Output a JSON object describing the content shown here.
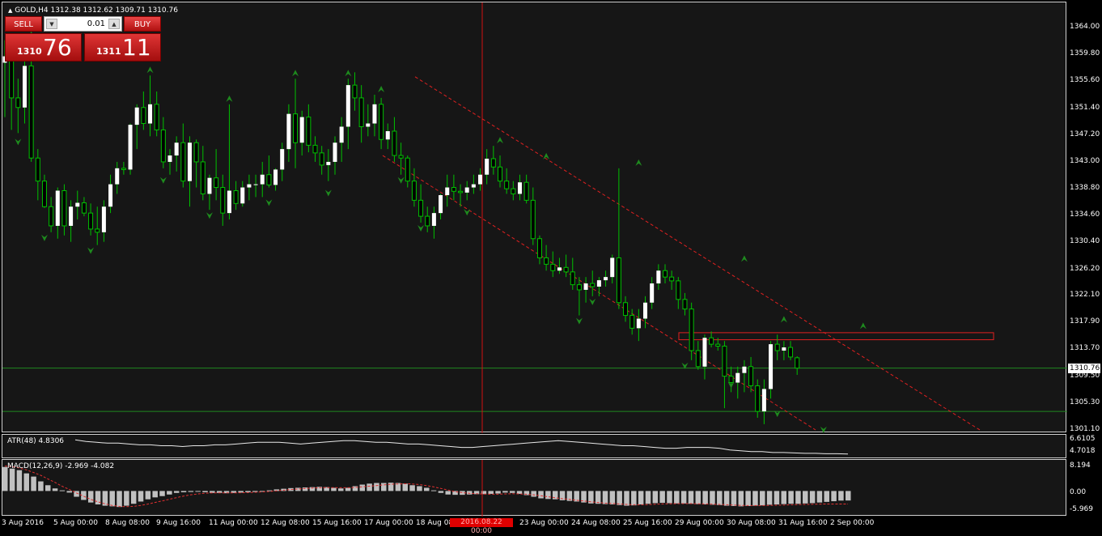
{
  "window": {
    "title": "GOLD,H4  1312.38 1312.62 1309.71 1310.76",
    "symbol_menu_icon": "triangle-up-icon"
  },
  "trade_panel": {
    "sell_label": "SELL",
    "buy_label": "BUY",
    "lot_value": "0.01",
    "sell_price_prefix": "1310",
    "sell_price_big": "76",
    "buy_price_prefix": "1311",
    "buy_price_big": "11"
  },
  "price_axis": {
    "labels": [
      "1364.00",
      "1359.80",
      "1355.60",
      "1351.40",
      "1347.20",
      "1343.00",
      "1338.80",
      "1334.60",
      "1330.40",
      "1326.20",
      "1322.10",
      "1317.90",
      "1313.70",
      "1310.76",
      "1309.50",
      "1305.30",
      "1301.10"
    ],
    "current_price": "1310.76"
  },
  "atr": {
    "title": "ATR(48) 4.8306",
    "axis": [
      "6.6105",
      "4.7018"
    ]
  },
  "macd": {
    "title": "MACD(12,26,9) -2.969 -4.082",
    "axis": [
      "8.194",
      "0.00",
      "-5.969"
    ]
  },
  "time_axis": {
    "labels": [
      "3 Aug 2016",
      "5 Aug 00:00",
      "8 Aug 08:00",
      "9 Aug 16:00",
      "11 Aug 00:00",
      "12 Aug 08:00",
      "15 Aug 16:00",
      "17 Aug 00:00",
      "18 Aug 08:00",
      "23 Aug 00:00",
      "24 Aug 08:00",
      "25 Aug 16:00",
      "29 Aug 00:00",
      "30 Aug 08:00",
      "31 Aug 16:00",
      "2 Sep 00:00"
    ],
    "crosshair_time": "2016.08.22 00:00"
  },
  "colors": {
    "background": "#161616",
    "bull": "#ffffff",
    "bear": "#000000",
    "wick": "#00c000",
    "fractal": "#1e8a1e",
    "channel": "#e02020",
    "level": "#1f8a1f",
    "macd_hist": "#c0c0c0",
    "macd_signal": "#e03030"
  },
  "chart_data": {
    "type": "candlestick",
    "symbol": "GOLD",
    "timeframe": "H4",
    "ohlc_last": {
      "open": 1312.38,
      "high": 1312.62,
      "low": 1309.71,
      "close": 1310.76
    },
    "ylim": [
      1301.1,
      1364.0
    ],
    "candles": [
      [
        1358.5,
        1362,
        1350,
        1359.5
      ],
      [
        1359.5,
        1361.5,
        1348,
        1353
      ],
      [
        1353,
        1356,
        1347.5,
        1351.5
      ],
      [
        1351.5,
        1359,
        1349,
        1358
      ],
      [
        1358,
        1362,
        1343,
        1343.6
      ],
      [
        1343.6,
        1345,
        1337,
        1340
      ],
      [
        1340,
        1341,
        1335.8,
        1336
      ],
      [
        1336,
        1337.5,
        1332,
        1333
      ],
      [
        1333,
        1339,
        1331,
        1338.5
      ],
      [
        1338.5,
        1339.5,
        1331.5,
        1333
      ],
      [
        1333,
        1337,
        1330.5,
        1336
      ],
      [
        1336,
        1338.5,
        1334,
        1336.6
      ],
      [
        1336.6,
        1337.5,
        1334.5,
        1335
      ],
      [
        1335,
        1336.5,
        1331.5,
        1332.5
      ],
      [
        1332.5,
        1336,
        1330,
        1332
      ],
      [
        1332,
        1337,
        1330.5,
        1336
      ],
      [
        1336,
        1341,
        1335,
        1339.5
      ],
      [
        1339.5,
        1343,
        1338,
        1342
      ],
      [
        1342,
        1343,
        1341,
        1341.8
      ],
      [
        1341.8,
        1349,
        1341,
        1348.8
      ],
      [
        1348.8,
        1352,
        1345,
        1351.5
      ],
      [
        1351.5,
        1354,
        1348,
        1349
      ],
      [
        1349,
        1356.5,
        1347,
        1352
      ],
      [
        1352,
        1354,
        1347,
        1348
      ],
      [
        1348,
        1350,
        1342,
        1343
      ],
      [
        1343,
        1345,
        1341,
        1344
      ],
      [
        1344,
        1347,
        1341.5,
        1346
      ],
      [
        1346,
        1349,
        1339,
        1340
      ],
      [
        1340,
        1347,
        1336,
        1346
      ],
      [
        1346,
        1346.5,
        1339,
        1343
      ],
      [
        1343,
        1345.5,
        1337,
        1338
      ],
      [
        1338,
        1341,
        1335.5,
        1340.5
      ],
      [
        1340.5,
        1345,
        1337,
        1339
      ],
      [
        1339,
        1341,
        1333,
        1335
      ],
      [
        1335,
        1352,
        1334,
        1338.5
      ],
      [
        1338.5,
        1340,
        1335.5,
        1336.5
      ],
      [
        1336.5,
        1340,
        1336,
        1339
      ],
      [
        1339,
        1341,
        1337,
        1339.5
      ],
      [
        1339.5,
        1341,
        1337.5,
        1339.5
      ],
      [
        1339.5,
        1343,
        1337.5,
        1341
      ],
      [
        1341,
        1344,
        1339,
        1339.4
      ],
      [
        1339.4,
        1342,
        1338.5,
        1341.8
      ],
      [
        1341.8,
        1346,
        1340,
        1345
      ],
      [
        1345,
        1352,
        1343,
        1350.5
      ],
      [
        1350.5,
        1356,
        1342,
        1346
      ],
      [
        1346,
        1351,
        1344,
        1350
      ],
      [
        1350,
        1352,
        1344.5,
        1345.6
      ],
      [
        1345.6,
        1347,
        1343,
        1344.4
      ],
      [
        1344.4,
        1345.5,
        1341,
        1342.5
      ],
      [
        1342.5,
        1345,
        1340,
        1343
      ],
      [
        1343,
        1347,
        1341,
        1346
      ],
      [
        1346,
        1350,
        1343,
        1348.5
      ],
      [
        1348.5,
        1356,
        1345,
        1355
      ],
      [
        1355,
        1357,
        1351,
        1353
      ],
      [
        1353,
        1355,
        1346,
        1348.5
      ],
      [
        1348.5,
        1352,
        1347,
        1349
      ],
      [
        1349,
        1353.5,
        1347,
        1352
      ],
      [
        1352,
        1353,
        1345,
        1346.5
      ],
      [
        1346.5,
        1349,
        1345,
        1347.8
      ],
      [
        1347.8,
        1350,
        1343,
        1344
      ],
      [
        1344,
        1346,
        1341,
        1343.6
      ],
      [
        1343.6,
        1344,
        1339,
        1340
      ],
      [
        1340,
        1342,
        1336,
        1337
      ],
      [
        1337,
        1339.5,
        1333.5,
        1334.5
      ],
      [
        1334.5,
        1336,
        1332,
        1333
      ],
      [
        1333,
        1336,
        1331,
        1335
      ],
      [
        1335,
        1338,
        1334,
        1337.8
      ],
      [
        1337.8,
        1341,
        1336,
        1339
      ],
      [
        1339,
        1341,
        1337,
        1338.4
      ],
      [
        1338.4,
        1339.5,
        1336,
        1338.2
      ],
      [
        1338.2,
        1340,
        1337,
        1339
      ],
      [
        1339,
        1341,
        1338,
        1339.5
      ],
      [
        1339.5,
        1342,
        1338.5,
        1341
      ],
      [
        1341,
        1345,
        1339.5,
        1343.5
      ],
      [
        1343.5,
        1345.5,
        1341,
        1342.2
      ],
      [
        1342.2,
        1344,
        1339,
        1340
      ],
      [
        1340,
        1342,
        1338,
        1338.8
      ],
      [
        1338.8,
        1340,
        1337,
        1338
      ],
      [
        1338,
        1341,
        1337,
        1339.8
      ],
      [
        1339.8,
        1341,
        1336.5,
        1337
      ],
      [
        1337,
        1339,
        1330,
        1331
      ],
      [
        1331,
        1331.5,
        1327,
        1328
      ],
      [
        1328,
        1330,
        1326,
        1327
      ],
      [
        1327,
        1329,
        1325,
        1326
      ],
      [
        1326,
        1328,
        1325.5,
        1326.5
      ],
      [
        1326.5,
        1328.5,
        1325,
        1325.8
      ],
      [
        1325.8,
        1328,
        1323,
        1323.8
      ],
      [
        1323.8,
        1325,
        1319,
        1323
      ],
      [
        1323,
        1325,
        1321,
        1324
      ],
      [
        1324,
        1326,
        1322,
        1323.5
      ],
      [
        1323.5,
        1325,
        1322,
        1324.5
      ],
      [
        1324.5,
        1326,
        1323.5,
        1325
      ],
      [
        1325,
        1328.5,
        1324,
        1328
      ],
      [
        1328,
        1342,
        1320,
        1321
      ],
      [
        1321,
        1322,
        1318,
        1319
      ],
      [
        1319,
        1320,
        1316,
        1317
      ],
      [
        1317,
        1320,
        1315,
        1318.5
      ],
      [
        1318.5,
        1322,
        1317,
        1321
      ],
      [
        1321,
        1325,
        1320,
        1324
      ],
      [
        1324,
        1327,
        1323,
        1326
      ],
      [
        1326,
        1327,
        1324,
        1325
      ],
      [
        1325,
        1326,
        1323,
        1324.4
      ],
      [
        1324.4,
        1325,
        1320,
        1321.5
      ],
      [
        1321.5,
        1322.5,
        1319,
        1320
      ],
      [
        1320,
        1321,
        1312,
        1313.5
      ],
      [
        1313.5,
        1315,
        1310.5,
        1311
      ],
      [
        1311,
        1316,
        1309,
        1315.5
      ],
      [
        1315.5,
        1316.5,
        1314,
        1314.5
      ],
      [
        1314.5,
        1315.5,
        1313.5,
        1314.2
      ],
      [
        1314.2,
        1315,
        1304.5,
        1309.5
      ],
      [
        1309.5,
        1311,
        1307,
        1308.5
      ],
      [
        1308.5,
        1311,
        1306,
        1310
      ],
      [
        1310,
        1312,
        1307,
        1311
      ],
      [
        1311,
        1312.5,
        1307,
        1308
      ],
      [
        1308,
        1309,
        1303,
        1304
      ],
      [
        1304,
        1309,
        1302,
        1307.5
      ],
      [
        1307.5,
        1315,
        1306,
        1314.5
      ],
      [
        1314.5,
        1316,
        1312,
        1313.5
      ],
      [
        1313.5,
        1315,
        1312,
        1314
      ],
      [
        1314,
        1315,
        1312,
        1312.5
      ],
      [
        1312.38,
        1312.62,
        1309.71,
        1310.76
      ]
    ],
    "fractals_up": [
      [
        4,
        1362
      ],
      [
        22,
        1356.5
      ],
      [
        34,
        1352
      ],
      [
        44,
        1356
      ],
      [
        52,
        1356
      ],
      [
        57,
        1353.5
      ],
      [
        75,
        1345.5
      ],
      [
        82,
        1343
      ],
      [
        96,
        1342
      ],
      [
        112,
        1327
      ],
      [
        118,
        1317.5
      ],
      [
        130,
        1316.5
      ]
    ],
    "fractals_down": [
      [
        2,
        1347
      ],
      [
        6,
        1332
      ],
      [
        13,
        1330
      ],
      [
        24,
        1341
      ],
      [
        31,
        1335.5
      ],
      [
        40,
        1337.5
      ],
      [
        49,
        1339
      ],
      [
        60,
        1341
      ],
      [
        63,
        1333.5
      ],
      [
        70,
        1336
      ],
      [
        87,
        1319
      ],
      [
        89,
        1322
      ],
      [
        103,
        1312
      ],
      [
        110,
        1309
      ],
      [
        117,
        1304.5
      ],
      [
        124,
        1302
      ]
    ],
    "channel_upper": [
      [
        1326.5,
        1356.8
      ],
      [
        1332.0,
        1349.6
      ],
      [
        1337.5,
        1342.4
      ],
      [
        1343.0,
        1335.2
      ]
    ],
    "channel_lower": [
      [
        1301.1,
        1344.0
      ],
      [
        1313.0,
        1332.5
      ],
      [
        1320.0,
        1325.0
      ]
    ],
    "horizontal_levels": [
      1310.76,
      1304.0
    ],
    "resistance_zone": {
      "from_price": 1315.2,
      "to_price": 1316.3
    },
    "crosshair_time": "2016.08.22 00:00",
    "atr_series": [
      6.5,
      6.3,
      6.2,
      6.1,
      6.1,
      6.0,
      5.9,
      5.9,
      5.8,
      5.8,
      5.7,
      5.8,
      5.8,
      5.9,
      5.9,
      6.0,
      6.1,
      6.2,
      6.2,
      6.2,
      6.1,
      6.0,
      6.1,
      6.2,
      6.3,
      6.4,
      6.4,
      6.3,
      6.2,
      6.2,
      6.1,
      6.0,
      6.0,
      5.9,
      5.8,
      5.7,
      5.6,
      5.6,
      5.7,
      5.8,
      5.9,
      6.0,
      6.1,
      6.2,
      6.3,
      6.4,
      6.3,
      6.2,
      6.1,
      6.0,
      5.9,
      5.8,
      5.8,
      5.7,
      5.6,
      5.5,
      5.5,
      5.6,
      5.6,
      5.6,
      5.5,
      5.3,
      5.2,
      5.1,
      5.1,
      5.0,
      5.0,
      4.95,
      4.9,
      4.9,
      4.85,
      4.85,
      4.83
    ],
    "atr_range": [
      4.7018,
      6.6105
    ],
    "macd_hist": [
      7.5,
      7.0,
      6.5,
      5.5,
      4.5,
      3.0,
      1.8,
      0.8,
      0.2,
      -0.5,
      -1.8,
      -2.8,
      -3.6,
      -4.2,
      -4.6,
      -4.8,
      -5.0,
      -4.6,
      -4.0,
      -3.3,
      -2.6,
      -2.0,
      -1.6,
      -1.1,
      -0.6,
      -0.4,
      -0.3,
      -0.2,
      -0.4,
      -0.6,
      -0.6,
      -0.7,
      -0.6,
      -0.5,
      -0.4,
      -0.3,
      -0.2,
      0.2,
      0.5,
      0.7,
      0.9,
      1.0,
      1.1,
      1.2,
      1.3,
      1.2,
      1.0,
      0.8,
      1.0,
      1.5,
      2.0,
      2.3,
      2.5,
      2.5,
      2.6,
      2.5,
      2.3,
      1.8,
      1.5,
      1.0,
      0.2,
      -0.6,
      -1.1,
      -1.2,
      -1.2,
      -1.1,
      -1.0,
      -1.0,
      -0.9,
      -0.8,
      -0.5,
      -0.6,
      -0.9,
      -1.3,
      -1.8,
      -2.3,
      -2.5,
      -2.6,
      -2.9,
      -3.1,
      -3.3,
      -3.6,
      -3.9,
      -4.0,
      -4.1,
      -4.2,
      -4.4,
      -4.6,
      -4.5,
      -4.2,
      -4.0,
      -3.8,
      -3.7,
      -3.8,
      -3.9,
      -3.9,
      -4.0,
      -4.1,
      -4.2,
      -4.3,
      -4.4,
      -4.6,
      -4.7,
      -4.8,
      -4.7,
      -4.6,
      -4.5,
      -4.3,
      -4.2,
      -4.1,
      -4.0,
      -4.0,
      -3.9,
      -3.8,
      -3.6,
      -3.4,
      -3.2,
      -3.0,
      -2.97
    ],
    "macd_signal": [
      7.8,
      7.6,
      7.2,
      6.6,
      5.8,
      4.9,
      3.8,
      2.7,
      1.5,
      0.5,
      -0.6,
      -1.6,
      -2.6,
      -3.4,
      -4.0,
      -4.5,
      -4.8,
      -4.9,
      -4.8,
      -4.5,
      -4.1,
      -3.6,
      -3.1,
      -2.6,
      -2.1,
      -1.6,
      -1.2,
      -0.9,
      -0.7,
      -0.6,
      -0.6,
      -0.6,
      -0.6,
      -0.55,
      -0.5,
      -0.4,
      -0.3,
      -0.15,
      0.05,
      0.25,
      0.45,
      0.6,
      0.75,
      0.9,
      1.0,
      1.05,
      1.05,
      1.0,
      1.0,
      1.1,
      1.3,
      1.5,
      1.7,
      1.9,
      2.1,
      2.2,
      2.25,
      2.2,
      2.0,
      1.7,
      1.3,
      0.8,
      0.3,
      -0.2,
      -0.5,
      -0.7,
      -0.85,
      -0.95,
      -1.0,
      -1.0,
      -0.9,
      -0.85,
      -0.9,
      -1.0,
      -1.2,
      -1.5,
      -1.8,
      -2.1,
      -2.4,
      -2.6,
      -2.9,
      -3.1,
      -3.4,
      -3.6,
      -3.8,
      -3.9,
      -4.05,
      -4.2,
      -4.3,
      -4.3,
      -4.25,
      -4.15,
      -4.05,
      -4.0,
      -3.95,
      -3.95,
      -3.95,
      -4.0,
      -4.05,
      -4.1,
      -4.2,
      -4.3,
      -4.4,
      -4.5,
      -4.55,
      -4.55,
      -4.55,
      -4.5,
      -4.45,
      -4.4,
      -4.3,
      -4.25,
      -4.2,
      -4.15,
      -4.1,
      -4.08,
      -4.08,
      -4.08,
      -4.082
    ],
    "macd_range": [
      -5.969,
      8.194
    ]
  }
}
